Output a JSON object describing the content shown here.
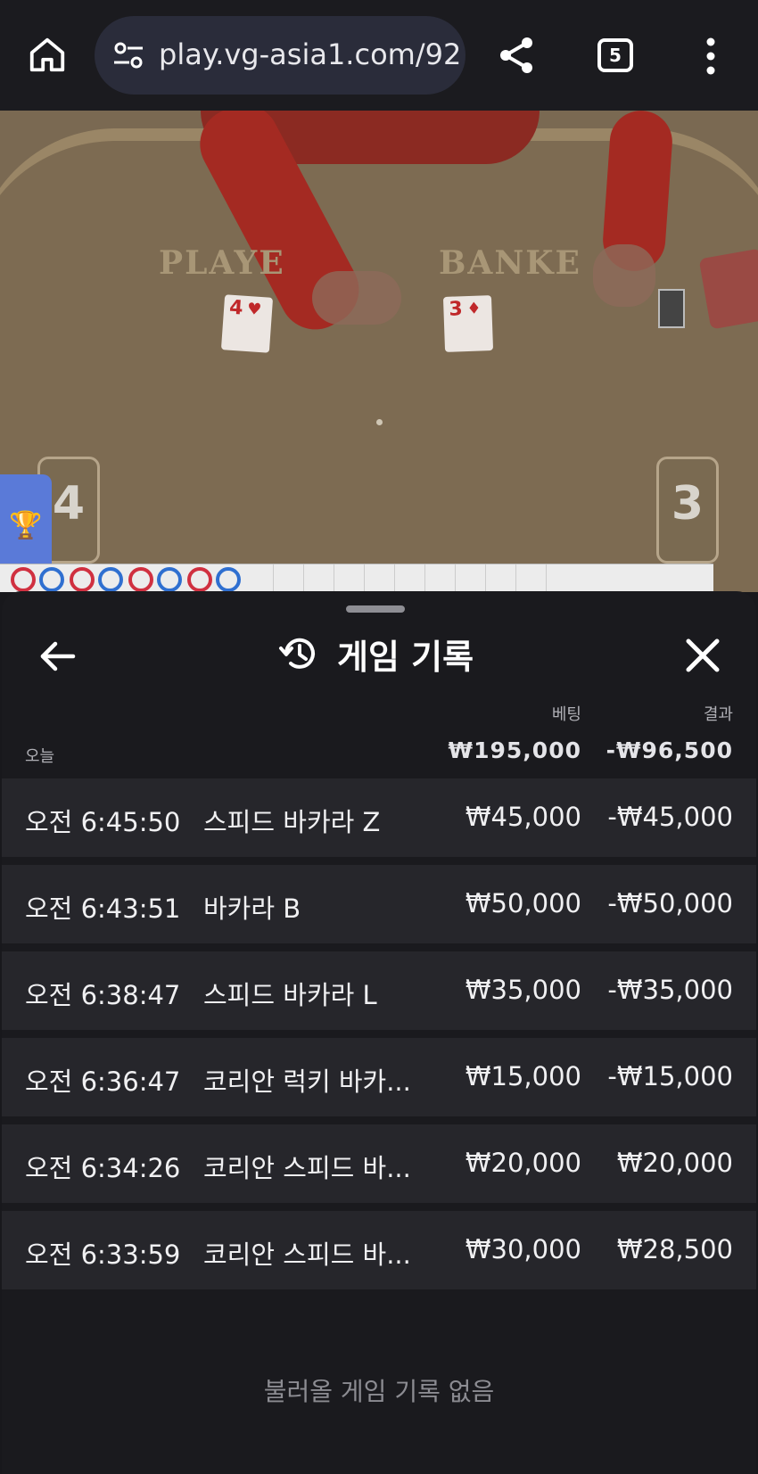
{
  "browser": {
    "url": "play.vg-asia1.com/92",
    "tab_count": "5",
    "icons": [
      "home-icon",
      "site-settings-icon",
      "share-icon",
      "tab-switcher-icon",
      "more-vert-icon"
    ]
  },
  "game_view": {
    "player_label": "PLAYE",
    "banker_label": "BANKE",
    "player_card": {
      "rank": "4",
      "suit": "♥"
    },
    "banker_card": {
      "rank": "3",
      "suit": "♦"
    },
    "player_score": "4",
    "banker_score": "3",
    "trophy_icon": "trophy-icon"
  },
  "sheet": {
    "title": "게임 기록",
    "header": {
      "bet_label": "베팅",
      "result_label": "결과",
      "today_label": "오늘",
      "total_bet": "₩195,000",
      "total_result": "-₩96,500"
    },
    "rows": [
      {
        "time": "오전 6:45:50",
        "game": "스피드 바카라 Z",
        "bet": "₩45,000",
        "result": "-₩45,000"
      },
      {
        "time": "오전 6:43:51",
        "game": "바카라 B",
        "bet": "₩50,000",
        "result": "-₩50,000"
      },
      {
        "time": "오전 6:38:47",
        "game": "스피드 바카라 L",
        "bet": "₩35,000",
        "result": "-₩35,000"
      },
      {
        "time": "오전 6:36:47",
        "game": "코리안 럭키 바카...",
        "bet": "₩15,000",
        "result": "-₩15,000"
      },
      {
        "time": "오전 6:34:26",
        "game": "코리안 스피드 바...",
        "bet": "₩20,000",
        "result": "₩20,000"
      },
      {
        "time": "오전 6:33:59",
        "game": "코리안 스피드 바...",
        "bet": "₩30,000",
        "result": "₩28,500"
      }
    ],
    "empty_message": "불러올 게임 기록 없음"
  },
  "colors": {
    "sheet_bg": "#1a1a1e",
    "row_bg": "#26262b",
    "browser_bg": "#1b1b1f",
    "url_pill": "#2a2c3a"
  }
}
